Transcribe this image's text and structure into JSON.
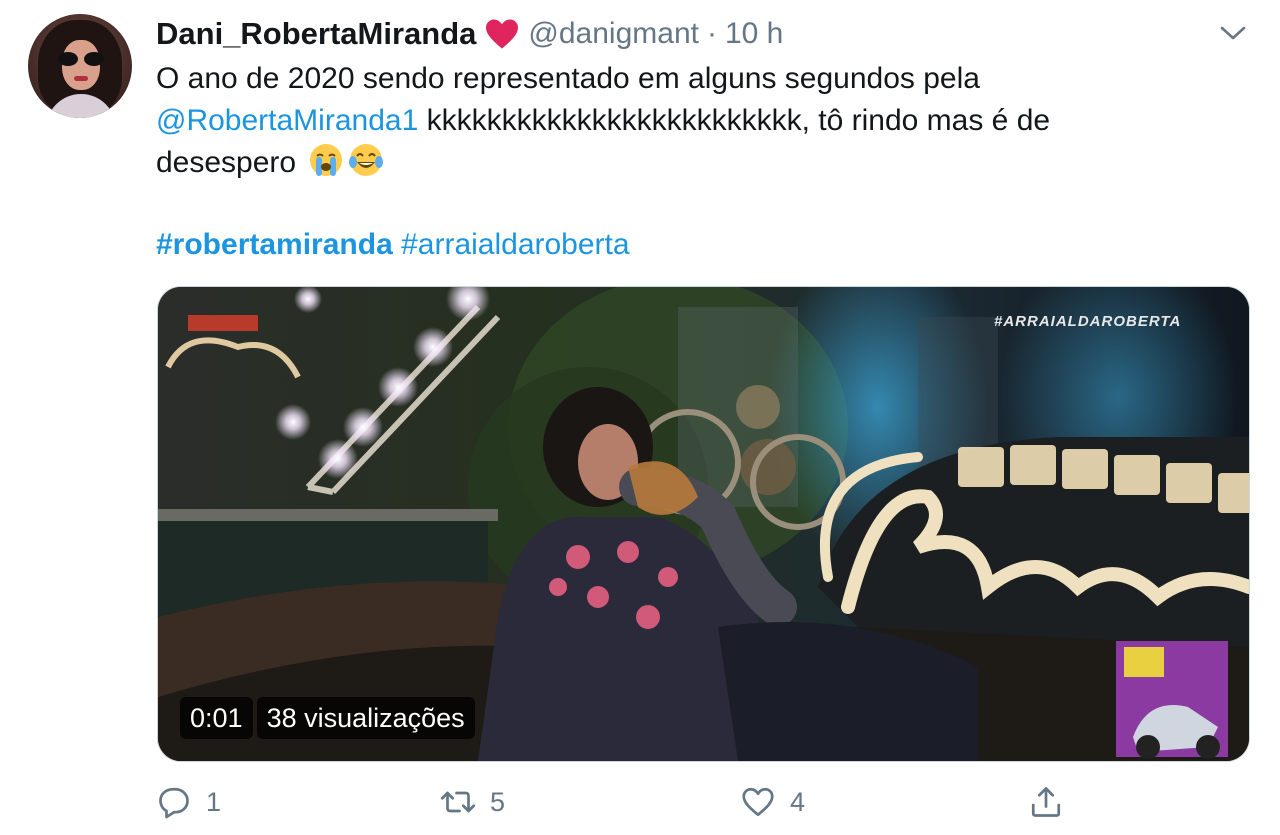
{
  "author": {
    "display_name": "Dani_RobertaMiranda",
    "handle": "@danigmant",
    "separator": "·",
    "time": "10 h"
  },
  "tweet": {
    "line1": "O ano de 2020 sendo representado em alguns segundos pela",
    "mention": "@RobertaMiranda1",
    "line2_rest": " kkkkkkkkkkkkkkkkkkkkkkkkk, tô rindo mas é de",
    "line3": "desespero",
    "hashtag1": "#robertamiranda",
    "hashtag2": "#arraialdaroberta"
  },
  "media": {
    "type": "video",
    "time": "0:01",
    "views": "38 visualizações",
    "overlay_hashtag": "#ARRAIALDAROBERTA"
  },
  "actions": {
    "replies": "1",
    "retweets": "5",
    "likes": "4"
  },
  "colors": {
    "link": "#1b95e0",
    "secondary": "#657786",
    "heart": "#e0245e"
  },
  "icons": [
    "heart-icon",
    "chevron-down-icon",
    "loudly-crying-face-emoji",
    "tears-of-joy-emoji",
    "reply-icon",
    "retweet-icon",
    "like-icon",
    "share-icon"
  ]
}
